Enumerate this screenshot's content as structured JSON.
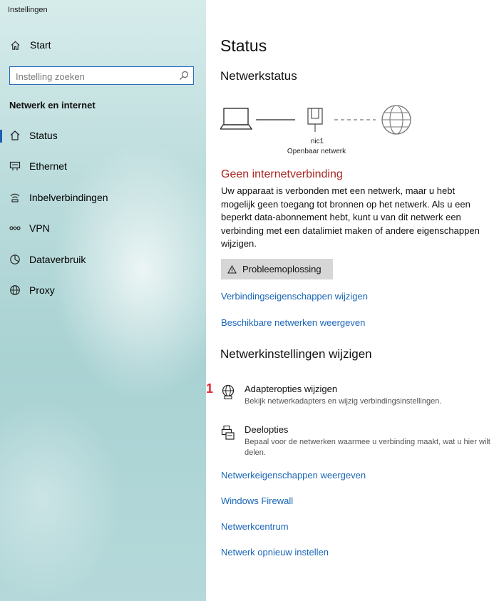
{
  "window": {
    "title": "Instellingen"
  },
  "sidebar": {
    "home_label": "Start",
    "search_placeholder": "Instelling zoeken",
    "section_title": "Netwerk en internet",
    "items": [
      {
        "label": "Status",
        "icon": "home-status-icon"
      },
      {
        "label": "Ethernet",
        "icon": "ethernet-icon"
      },
      {
        "label": "Inbelverbindingen",
        "icon": "dialup-icon"
      },
      {
        "label": "VPN",
        "icon": "vpn-icon"
      },
      {
        "label": "Dataverbruik",
        "icon": "data-usage-icon"
      },
      {
        "label": "Proxy",
        "icon": "globe-icon"
      }
    ]
  },
  "main": {
    "title": "Status",
    "network_status_heading": "Netwerkstatus",
    "diagram": {
      "adapter_name": "nic1",
      "network_type": "Openbaar netwerk"
    },
    "error_title": "Geen internetverbinding",
    "error_description": "Uw apparaat is verbonden met een netwerk, maar u hebt mogelijk geen toegang tot bronnen op het netwerk. Als u een beperkt data-abonnement hebt, kunt u van dit netwerk een verbinding met een datalimiet maken of andere eigenschappen wijzigen.",
    "troubleshoot_label": "Probleemoplossing",
    "link_connection_props": "Verbindingseigenschappen wijzigen",
    "link_available_networks": "Beschikbare netwerken weergeven",
    "change_settings_heading": "Netwerkinstellingen wijzigen",
    "annotation_number": "1",
    "adapter_options": {
      "title": "Adapteropties wijzigen",
      "subtitle": "Bekijk netwerkadapters en wijzig verbindingsinstellingen."
    },
    "sharing_options": {
      "title": "Deelopties",
      "subtitle": "Bepaal voor de netwerken waarmee u verbinding maakt, wat u hier wilt delen."
    },
    "links": [
      "Netwerkeigenschappen weergeven",
      "Windows Firewall",
      "Netwerkcentrum",
      "Netwerk opnieuw instellen"
    ]
  }
}
